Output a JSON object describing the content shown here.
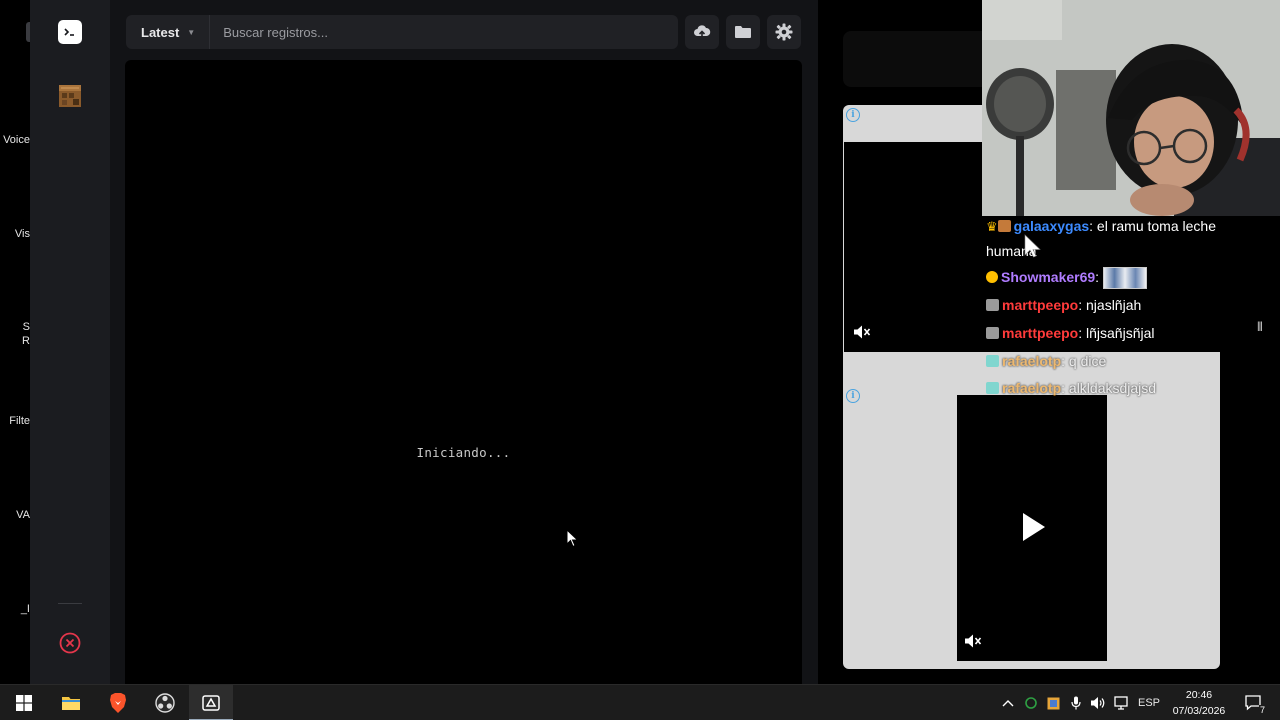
{
  "left_dock": {
    "cut_labels": [
      "Voice",
      "Vis",
      "S",
      "R",
      "Filte",
      "VA",
      "_I"
    ]
  },
  "launcher": {
    "version_label": "Latest",
    "search_placeholder": "Buscar registros...",
    "console_status": "Iniciando..."
  },
  "chat": {
    "messages": [
      {
        "user": "galaaxygas",
        "text": ": el ramu toma leche humana",
        "color": "#3d8bff"
      },
      {
        "user": "Showmaker69",
        "text": ":",
        "color": "#b07cff",
        "emote": true
      },
      {
        "user": "marttpeepo",
        "text": ": njaslñjah",
        "color": "#ff3b3b"
      },
      {
        "user": "marttpeepo",
        "text": ": lñjsañjsñjal",
        "color": "#ff3b3b"
      },
      {
        "user": "rafaelotp",
        "text": ": q dice",
        "color": "#ff9f1a"
      },
      {
        "user": "rafaelotp",
        "text": ": alkldaksdjajsd",
        "color": "#ff9f1a"
      }
    ]
  },
  "taskbar": {
    "lang": "ESP",
    "time": "20:46",
    "date": "07/03/2026",
    "notifications": "7"
  },
  "colors": {
    "accent_red": "#e5364b",
    "info_blue": "#4aa3df"
  }
}
